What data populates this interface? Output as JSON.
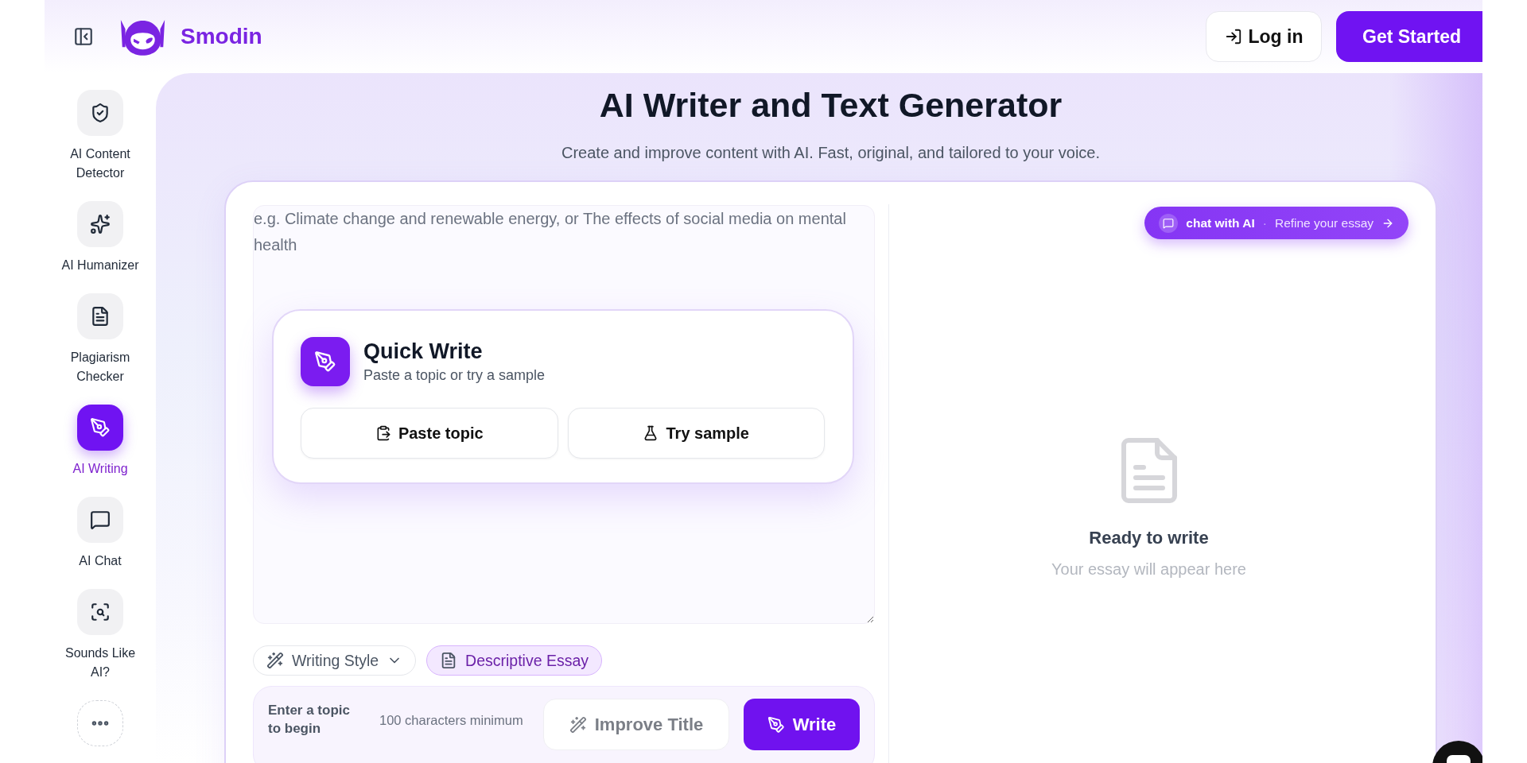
{
  "header": {
    "brand": "Smodin",
    "login_button": {
      "label": "Log in"
    },
    "cta_button": {
      "label": "Get Started"
    }
  },
  "sidebar": {
    "items": [
      {
        "kind": "tool",
        "label": "AI Content Detector",
        "selected": false
      },
      {
        "kind": "tool",
        "label": "AI Humanizer",
        "selected": false
      },
      {
        "kind": "tool",
        "label": "Plagiarism Checker",
        "selected": false
      },
      {
        "kind": "tool",
        "label": "AI Writing",
        "selected": true
      },
      {
        "kind": "tool",
        "label": "AI Chat",
        "selected": false
      },
      {
        "kind": "tool",
        "label": "Sounds Like AI?",
        "selected": false
      },
      {
        "kind": "more",
        "selected": false
      }
    ]
  },
  "page": {
    "title": "AI Writer and Text Generator",
    "subtitle": "Create and improve content with AI. Fast, original, and tailored to your voice."
  },
  "editor": {
    "topic_input": {
      "placeholder": "e.g. Climate change and renewable energy, or The effects of social media on mental health"
    },
    "quick_write": {
      "title": "Quick Write",
      "subtitle": "Paste a topic or try a sample",
      "buttons": [
        {
          "label": "Paste topic"
        },
        {
          "label": "Try sample"
        }
      ]
    },
    "writing_style": {
      "label": "Writing Style"
    },
    "essay_type": {
      "label": "Descriptive Essay"
    },
    "action_bar": {
      "hint": "Enter a topic to begin",
      "requirement": "100 characters minimum",
      "improve_button": {
        "label": "Improve Title",
        "disabled": true
      },
      "write_button": {
        "label": "Write",
        "disabled": false
      }
    }
  },
  "output": {
    "chat_button": {
      "label": "chat with AI",
      "separator": "·",
      "hint": "Refine your essay"
    },
    "empty_state": {
      "title": "Ready to write",
      "subtitle": "Your essay will appear here"
    }
  }
}
